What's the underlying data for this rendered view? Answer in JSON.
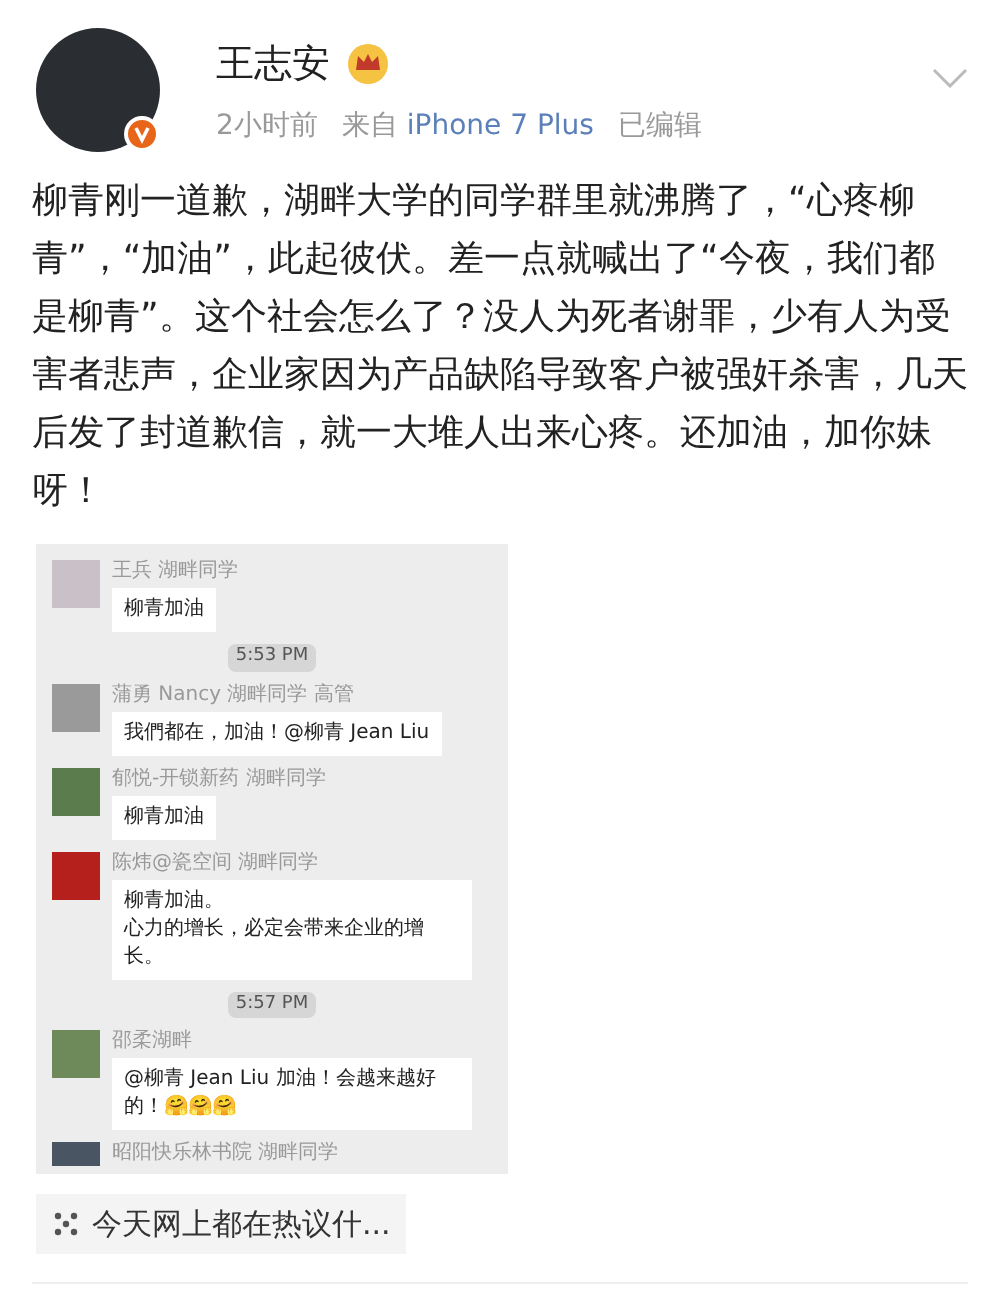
{
  "author": {
    "name": "王志安",
    "verified": true,
    "crown": true
  },
  "meta": {
    "time": "2小时前",
    "source_prefix": "来自",
    "source": "iPhone 7 Plus",
    "edited": "已编辑"
  },
  "body": "柳青刚一道歉，湖畔大学的同学群里就沸腾了，“心疼柳青”，“加油”，此起彼伏。差一点就喊出了“今夜，我们都是柳青”。这个社会怎么了？没人为死者谢罪，少有人为受害者悲声，企业家因为产品缺陷导致客户被强奸杀害，几天后发了封道歉信，就一大堆人出来心疼。还加油，加你妹呀！",
  "chat": [
    {
      "kind": "message",
      "sender": "王兵 湖畔同学",
      "text": "柳青加油"
    },
    {
      "kind": "time",
      "text": "5:53 PM"
    },
    {
      "kind": "message",
      "sender": "蒲勇 Nancy 湖畔同学 高管",
      "text": "我們都在，加油！@柳青 Jean Liu"
    },
    {
      "kind": "message",
      "sender": "郁悦-开锁新药 湖畔同学",
      "text": "柳青加油"
    },
    {
      "kind": "message",
      "sender": "陈炜@瓷空间 湖畔同学",
      "lines": [
        "柳青加油。",
        "心力的增长，必定会带来企业的增长。"
      ]
    },
    {
      "kind": "time",
      "text": "5:57 PM"
    },
    {
      "kind": "message",
      "sender": "邵柔湖畔",
      "text": "@柳青 Jean Liu 加油！会越来越好的！🤗🤗🤗"
    },
    {
      "kind": "cut",
      "sender": "昭阳快乐林书院 湖畔同学"
    }
  ],
  "link": {
    "text": "今天网上都在热议什..."
  }
}
